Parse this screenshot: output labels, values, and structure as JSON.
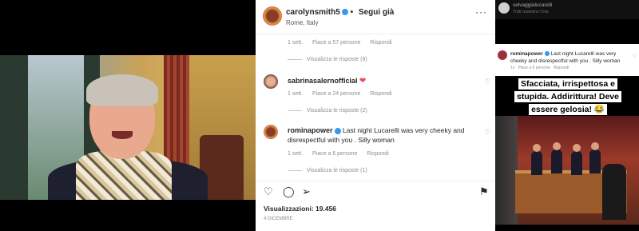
{
  "post": {
    "username": "carolynsmith5",
    "follow_label": "Segui già",
    "location": "Rome, Italy",
    "more_label": "···"
  },
  "comments": [
    {
      "time": "1 sett.",
      "likes": "Piace a 57 persone",
      "reply": "Rispondi",
      "view_replies": "Visualizza le risposte (8)"
    },
    {
      "username": "sabrinasalernofficial",
      "emoji": "❤",
      "time": "1 sett.",
      "likes": "Piace a 24 persone",
      "reply": "Rispondi",
      "view_replies": "Visualizza le risposte (2)"
    },
    {
      "username": "rominapower",
      "text": "Last night Lucarelli was very cheeky and disrespectful with you . Silly woman",
      "time": "1 sett.",
      "likes": "Piace a 6 persone",
      "reply": "Rispondi",
      "view_replies": "Visualizza le risposte (1)"
    }
  ],
  "actions": {
    "like_icon": "heart-icon",
    "comment_icon": "comment-icon",
    "share_icon": "send-icon",
    "save_icon": "bookmark-icon"
  },
  "views": "Visualizzazioni: 19.456",
  "date": "4 DICEMBRE",
  "story": {
    "username": "selvaggialucarelli",
    "subtitle": "Tutti usavano l'ora",
    "embedded_user": "rominapower",
    "embedded_text": "Last night Lucarelli was very cheeky and disrespectful with you . Silly woman",
    "embedded_time": "1s",
    "embedded_likes": "Piace a 6 persone",
    "embedded_reply": "Rispondi",
    "caption": "Sfacciata, irrispettosa e stupida. Addirittura! Deve essere gelosia! 😂"
  },
  "colors": {
    "verified": "#3897f0",
    "heart": "#ed4956",
    "text": "#262626",
    "muted": "#8e8e8e"
  }
}
